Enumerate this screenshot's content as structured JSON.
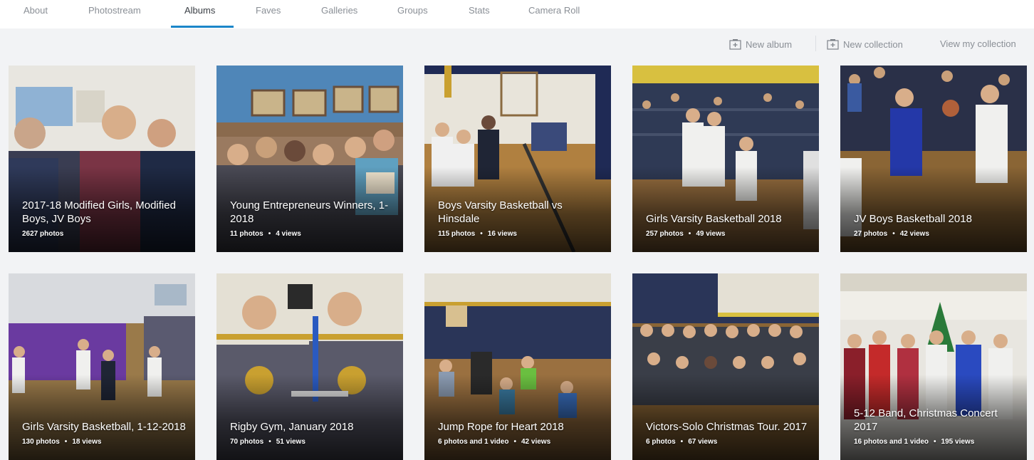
{
  "nav": {
    "tabs": [
      {
        "label": "About"
      },
      {
        "label": "Photostream"
      },
      {
        "label": "Albums"
      },
      {
        "label": "Faves"
      },
      {
        "label": "Galleries"
      },
      {
        "label": "Groups"
      },
      {
        "label": "Stats"
      },
      {
        "label": "Camera Roll"
      }
    ],
    "active_tab": "Albums",
    "accent_color": "#1b86c9"
  },
  "actions": {
    "new_album": "New album",
    "new_collection": "New collection",
    "view_collections": "View my collection"
  },
  "albums": [
    {
      "title": "2017-18 Modified Girls, Modified Boys, JV Boys",
      "stats": "2627 photos",
      "views": ""
    },
    {
      "title": "Young Entrepreneurs Winners, 1-2018",
      "stats": "11 photos",
      "views": "4 views"
    },
    {
      "title": "Boys Varsity Basketball vs Hinsdale",
      "stats": "115 photos",
      "views": "16 views"
    },
    {
      "title": "Girls Varsity Basketball 2018",
      "stats": "257 photos",
      "views": "49 views"
    },
    {
      "title": "JV Boys Basketball 2018",
      "stats": "27 photos",
      "views": "42 views"
    },
    {
      "title": "Girls Varsity Basketball, 1-12-2018",
      "stats": "130 photos",
      "views": "18 views"
    },
    {
      "title": "Rigby Gym, January 2018",
      "stats": "70 photos",
      "views": "51 views"
    },
    {
      "title": "Jump Rope for Heart 2018",
      "stats": "6 photos and 1 video",
      "views": "42 views"
    },
    {
      "title": "Victors-Solo Christmas Tour. 2017",
      "stats": "6 photos",
      "views": "67 views"
    },
    {
      "title": "5-12 Band, Christmas Concert 2017",
      "stats": "16 photos and 1 video",
      "views": "195 views"
    }
  ]
}
